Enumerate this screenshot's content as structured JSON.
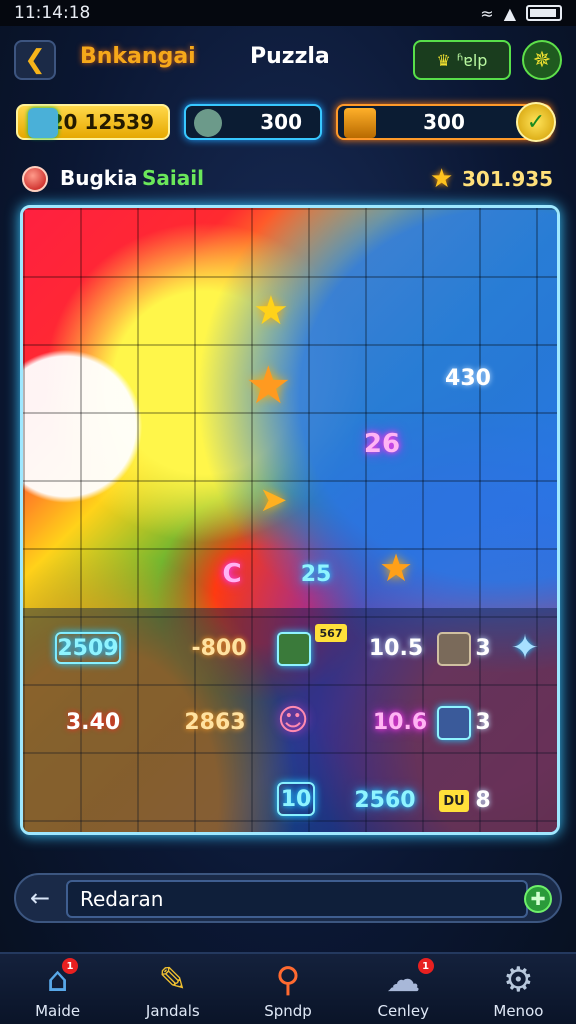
{
  "status_bar": {
    "time": "11:14:18",
    "signal_text": "ꀩ",
    "battery_icon": "battery-icon"
  },
  "header": {
    "back_icon": "back-arrow-icon",
    "game_name": "Bnkangai",
    "title": "Puzzla",
    "help_label": "ʱɐlp",
    "settings_icon": "star-settings-icon"
  },
  "resources": {
    "coins": "120 12539",
    "gems": "300",
    "chest": "300",
    "confirm_icon": "check-icon"
  },
  "level": {
    "name": "Bugkia",
    "subtitle": "Saiail",
    "score": "301.935"
  },
  "board": {
    "tiles": [
      {
        "id": "t-430",
        "text": "430",
        "style": "neon-white"
      },
      {
        "id": "t-26",
        "text": "26",
        "style": "neon-pink"
      },
      {
        "id": "t-c",
        "text": "C",
        "style": "neon-pink"
      },
      {
        "id": "t-25",
        "text": "25",
        "style": "neon-cyan"
      },
      {
        "id": "t-2509",
        "text": "2509",
        "style": "neon-cyan"
      },
      {
        "id": "t-800",
        "text": "-800",
        "style": "neon-orange"
      },
      {
        "id": "t-105",
        "text": "10.5",
        "style": "neon-white"
      },
      {
        "id": "t-3a",
        "text": "3",
        "style": "neon-white"
      },
      {
        "id": "t-340",
        "text": "3.40",
        "style": "neon-white"
      },
      {
        "id": "t-2863",
        "text": "2863",
        "style": "neon-orange"
      },
      {
        "id": "t-106",
        "text": "10.6",
        "style": "neon-pink"
      },
      {
        "id": "t-3b",
        "text": "3",
        "style": "neon-white"
      },
      {
        "id": "t-10",
        "text": "10",
        "style": "neon-cyan"
      },
      {
        "id": "t-2560",
        "text": "2560",
        "style": "neon-cyan"
      },
      {
        "id": "t-8",
        "text": "8",
        "style": "neon-white"
      }
    ],
    "mini_badge": "567",
    "gold_badge": "DU"
  },
  "input": {
    "value": "Redaran",
    "back_icon": "left-arrow-icon",
    "send_icon": "add-icon"
  },
  "nav": {
    "items": [
      {
        "label": "Maide",
        "icon": "home-icon",
        "badge": "1"
      },
      {
        "label": "Jandals",
        "icon": "pencil-icon",
        "badge": ""
      },
      {
        "label": "Spndp",
        "icon": "search-icon",
        "badge": ""
      },
      {
        "label": "Cenley",
        "icon": "cloud-icon",
        "badge": "1"
      },
      {
        "label": "Menoo",
        "icon": "gear-icon",
        "badge": ""
      }
    ]
  },
  "colors": {
    "accent_orange": "#f6a81a",
    "accent_green": "#58e04a",
    "neon_cyan": "#38c8ff",
    "neon_pink": "#ff40e0"
  }
}
